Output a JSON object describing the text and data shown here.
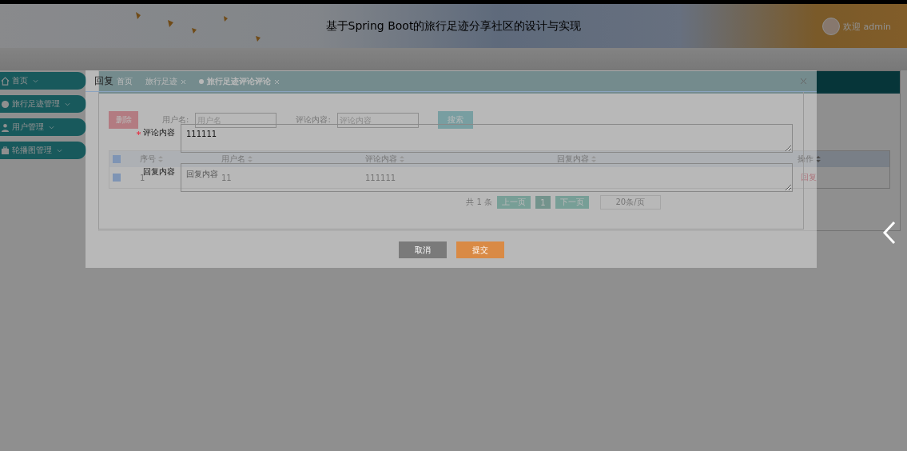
{
  "header": {
    "title": "基于Spring Boot的旅行足迹分享社区的设计与实现",
    "welcome": "欢迎 admin"
  },
  "sidebar": {
    "items": [
      {
        "label": "首页"
      },
      {
        "label": "旅行足迹管理"
      },
      {
        "label": "用户管理"
      },
      {
        "label": "轮播图管理"
      }
    ]
  },
  "tabs": [
    {
      "label": "首页",
      "selected": false,
      "closable": false
    },
    {
      "label": "旅行足迹",
      "selected": false,
      "closable": true
    },
    {
      "label": "旅行足迹评论评论",
      "selected": true,
      "closable": true
    }
  ],
  "search": {
    "delete_button": "删除",
    "fields": [
      {
        "label": "用户名:",
        "placeholder": "用户名"
      },
      {
        "label": "评论内容:",
        "placeholder": "评论内容"
      }
    ],
    "search_button": "搜索"
  },
  "table": {
    "select_all_checked": true,
    "columns": [
      "序号",
      "用户名",
      "评论内容",
      "回复内容",
      "操作"
    ],
    "rows": [
      {
        "checked": true,
        "index": "1",
        "username": "11",
        "comment": "111111",
        "action": "回复"
      }
    ]
  },
  "pagination": {
    "total": "共 1 条",
    "prev": "上一页",
    "pages": [
      {
        "label": "1",
        "selected": true
      }
    ],
    "next": "下一页",
    "page_size": "20条/页"
  },
  "dialog": {
    "title": "回复",
    "fields": [
      {
        "label": "评论内容",
        "required": true,
        "value": "111111"
      },
      {
        "label": "回复内容",
        "required": false,
        "placeholder": "回复内容"
      }
    ],
    "buttons": [
      {
        "label": "取消",
        "kind": "cancel"
      },
      {
        "label": "提交",
        "kind": "submit"
      }
    ]
  }
}
